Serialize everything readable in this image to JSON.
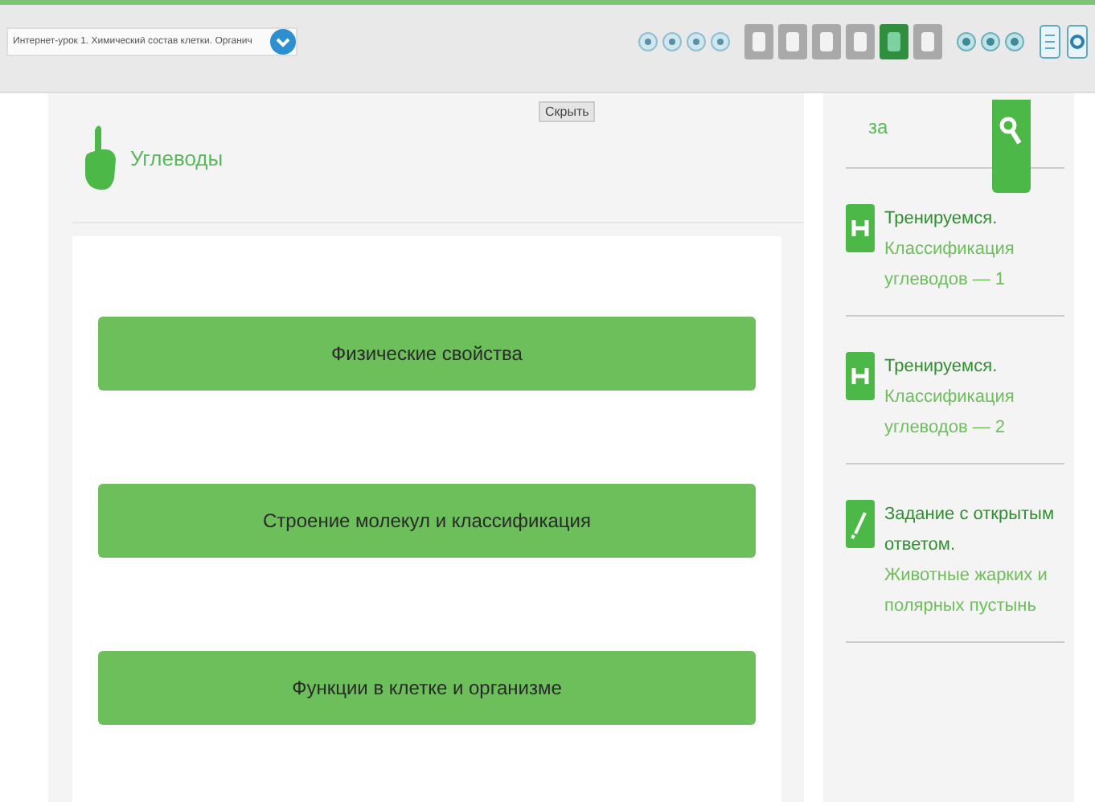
{
  "toolbar": {
    "lesson_select": {
      "value": "Интернет-урок 1. Химический состав клетки. Органич"
    },
    "nav_buttons": [
      {
        "selected": false
      },
      {
        "selected": false
      },
      {
        "selected": false
      },
      {
        "selected": false
      },
      {
        "selected": true
      },
      {
        "selected": false
      }
    ]
  },
  "content": {
    "hide_button": "Скрыть",
    "title": "Углеводы",
    "sections": [
      {
        "label": "Физические свойства"
      },
      {
        "label": "Строение молекул и классификация"
      },
      {
        "label": "Функции в клетке и организме"
      }
    ]
  },
  "sidebar": {
    "cut_text": "за",
    "items": [
      {
        "kind": "trainer",
        "title": "Тренируемся.",
        "subtitle": "Классификация углеводов — 1"
      },
      {
        "kind": "trainer",
        "title": "Тренируемся.",
        "subtitle": "Классификация углеводов — 2"
      },
      {
        "kind": "task",
        "title": "Задание с открытым ответом.",
        "subtitle": "Животные жарких и полярных пустынь"
      }
    ]
  }
}
